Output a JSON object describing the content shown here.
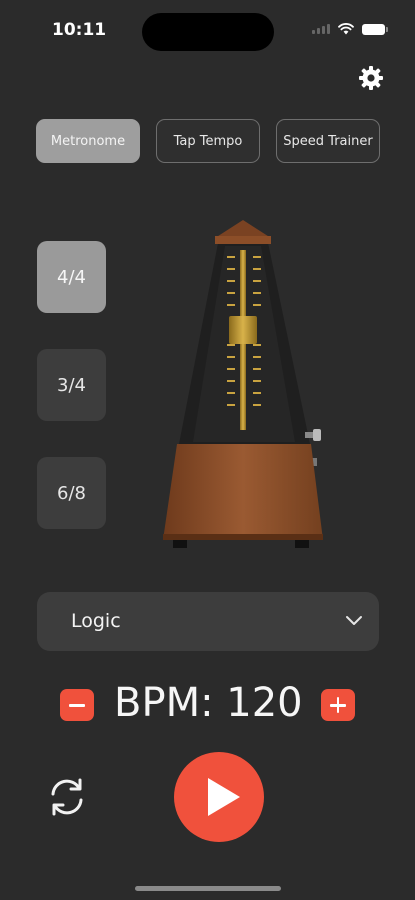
{
  "status_bar": {
    "time": "10:11"
  },
  "icons": {
    "settings": "gear-icon",
    "wifi": "wifi-icon",
    "battery": "battery-icon",
    "loop": "refresh-icon",
    "play": "play-icon",
    "dropdown": "chevron-down-icon"
  },
  "tabs": [
    {
      "label": "Metronome",
      "active": true
    },
    {
      "label": "Tap Tempo",
      "active": false
    },
    {
      "label": "Speed Trainer",
      "active": false
    }
  ],
  "time_signatures": [
    {
      "label": "4/4",
      "active": true
    },
    {
      "label": "3/4",
      "active": false
    },
    {
      "label": "6/8",
      "active": false
    }
  ],
  "sound": {
    "selected": "Logic"
  },
  "bpm": {
    "label": "BPM: 120"
  },
  "colors": {
    "background": "#2b2b2b",
    "accent": "#f0513c",
    "active_tab": "#9e9e9e",
    "control_bg": "#3d3d3d"
  }
}
